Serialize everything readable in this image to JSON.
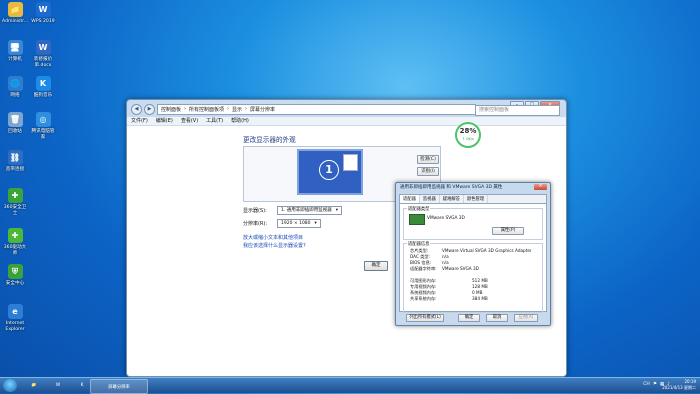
{
  "desktop": {
    "icons": [
      {
        "label": "Administr...",
        "glyph": "📁",
        "color": "#e7b93e"
      },
      {
        "label": "WPS 2019",
        "glyph": "W",
        "color": "#1c6bd1"
      },
      {
        "label": "计算机",
        "glyph": "🖥",
        "color": "#3a87d6"
      },
      {
        "label": "装修报价单.docx",
        "glyph": "W",
        "color": "#2f69c4"
      },
      {
        "label": "网络",
        "glyph": "🌐",
        "color": "#2f7bcf"
      },
      {
        "label": "酷狗音乐",
        "glyph": "K",
        "color": "#1a8be6"
      },
      {
        "label": "回收站",
        "glyph": "🗑",
        "color": "#7da6cf"
      },
      {
        "label": "腾讯电脑管家",
        "glyph": "◎",
        "color": "#2e8fe0"
      },
      {
        "label": "宽带连接",
        "glyph": "⛓",
        "color": "#2b6fc3"
      },
      {
        "label": "360安全卫士",
        "glyph": "✚",
        "color": "#3aa33a"
      },
      {
        "label": "360驱动大师",
        "glyph": "✚",
        "color": "#4cb83a"
      },
      {
        "label": "安全中心",
        "glyph": "⛨",
        "color": "#39a23c"
      },
      {
        "label": "Internet Explorer",
        "glyph": "e",
        "color": "#2d7ed6"
      }
    ]
  },
  "window": {
    "breadcrumb": [
      "控制面板",
      "所有控制面板项",
      "显示",
      "屏幕分辨率"
    ],
    "search_placeholder": "搜索控制面板",
    "controls": {
      "minimize": "–",
      "maximize": "□",
      "close": "✕"
    },
    "menu": [
      "文件(F)",
      "编辑(E)",
      "查看(V)",
      "工具(T)",
      "帮助(H)"
    ],
    "heading": "更改显示器的外观",
    "monitor_number": "1",
    "detect_button": "检测(C)",
    "identify_button": "识别(I)",
    "display_label": "显示器(S):",
    "display_value": "1. 通用非即插即用监视器",
    "resolution_label": "分辨率(R):",
    "resolution_value": "1920 × 1080",
    "link1": "放大或缩小文本和其他项目",
    "link2": "我应该选择什么显示器设置?",
    "ok_button": "确定"
  },
  "badge": {
    "percent": "28%",
    "sub": "↑ 0K/s"
  },
  "dialog": {
    "title": "通用非即插即用监视器 和 VMware SVGA 3D 属性",
    "close": "✕",
    "tabs": [
      "适配器",
      "监视器",
      "疑难解答",
      "颜色管理"
    ],
    "adapter_type_legend": "适配器类型",
    "adapter_name": "VMware SVGA 3D",
    "properties_button": "属性(P)",
    "info_legend": "适配器信息",
    "info": [
      {
        "k": "芯片类型:",
        "v": "VMware Virtual SVGA 3D Graphics Adapter"
      },
      {
        "k": "DAC 类型:",
        "v": "n/a"
      },
      {
        "k": "BIOS 信息:",
        "v": "n/a"
      },
      {
        "k": "适配器字符串:",
        "v": "VMware SVGA 3D"
      }
    ],
    "memory": [
      {
        "k": "可用图形内存:",
        "v": "512 MB"
      },
      {
        "k": "专用视频内存:",
        "v": "128 MB"
      },
      {
        "k": "系统视频内存:",
        "v": "0 MB"
      },
      {
        "k": "共享系统内存:",
        "v": "384 MB"
      }
    ],
    "list_modes_button": "列出所有模式(L)",
    "ok": "确定",
    "cancel": "取消",
    "apply": "应用(A)"
  },
  "taskbar": {
    "active_window": "屏幕分辨率",
    "tray_lang": "CH",
    "time": "20:19",
    "date": "2021/4/13 星期二"
  }
}
